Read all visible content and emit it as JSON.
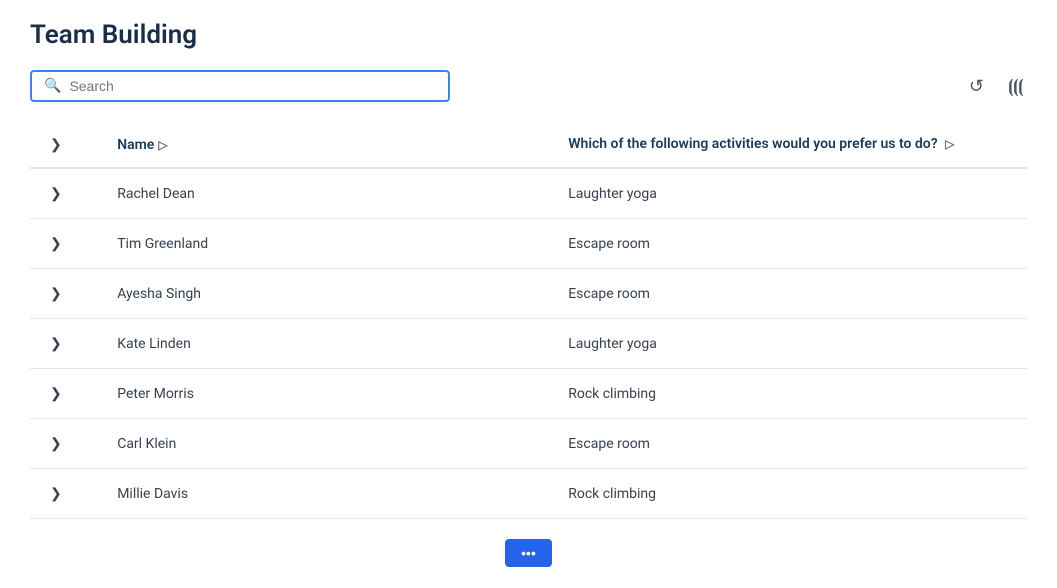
{
  "header": {
    "title": "Team Building"
  },
  "search": {
    "placeholder": "Search",
    "value": ""
  },
  "toolbar": {
    "refresh_label": "↺",
    "columns_label": "|||"
  },
  "table": {
    "columns": [
      {
        "key": "expand",
        "label": ""
      },
      {
        "key": "name",
        "label": "Name",
        "sortable": true
      },
      {
        "key": "activity",
        "label": "Which of the following activities would you prefer us to do?",
        "sortable": true
      }
    ],
    "rows": [
      {
        "name": "Rachel Dean",
        "activity": "Laughter yoga"
      },
      {
        "name": "Tim Greenland",
        "activity": "Escape room"
      },
      {
        "name": "Ayesha Singh",
        "activity": "Escape room"
      },
      {
        "name": "Kate Linden",
        "activity": "Laughter yoga"
      },
      {
        "name": "Peter Morris",
        "activity": "Rock climbing"
      },
      {
        "name": "Carl Klein",
        "activity": "Escape room"
      },
      {
        "name": "Millie Davis",
        "activity": "Rock climbing"
      }
    ]
  },
  "pagination": {
    "label": "..."
  }
}
